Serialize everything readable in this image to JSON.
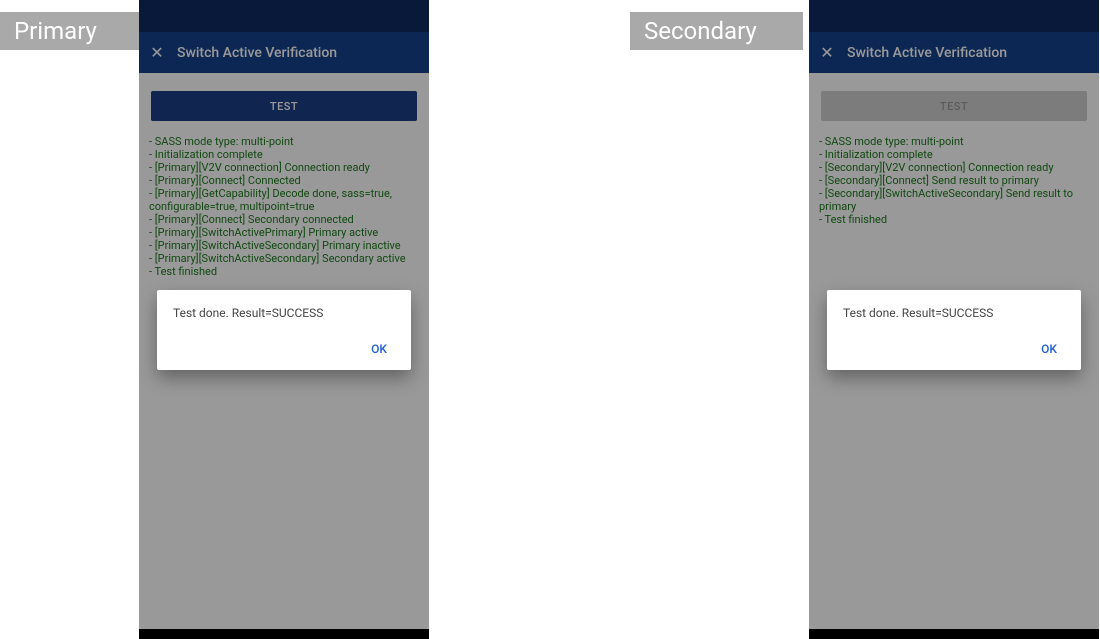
{
  "tags": {
    "primary": "Primary",
    "secondary": "Secondary"
  },
  "appbar": {
    "title": "Switch Active Verification",
    "close_glyph": "✕"
  },
  "test_button_label": "TEST",
  "dialog": {
    "message": "Test done. Result=SUCCESS",
    "ok_label": "OK"
  },
  "primary_log": "- SASS mode type: multi-point\n- Initialization complete\n- [Primary][V2V connection] Connection ready\n- [Primary][Connect] Connected\n- [Primary][GetCapability] Decode done, sass=true, configurable=true, multipoint=true\n- [Primary][Connect] Secondary connected\n- [Primary][SwitchActivePrimary] Primary active\n- [Primary][SwitchActiveSecondary] Primary inactive\n- [Primary][SwitchActiveSecondary] Secondary active\n- Test finished",
  "secondary_log": "- SASS mode type: multi-point\n- Initialization complete\n- [Secondary][V2V connection] Connection ready\n- [Secondary][Connect] Send result to primary\n- [Secondary][SwitchActiveSecondary] Send result to primary\n- Test finished"
}
